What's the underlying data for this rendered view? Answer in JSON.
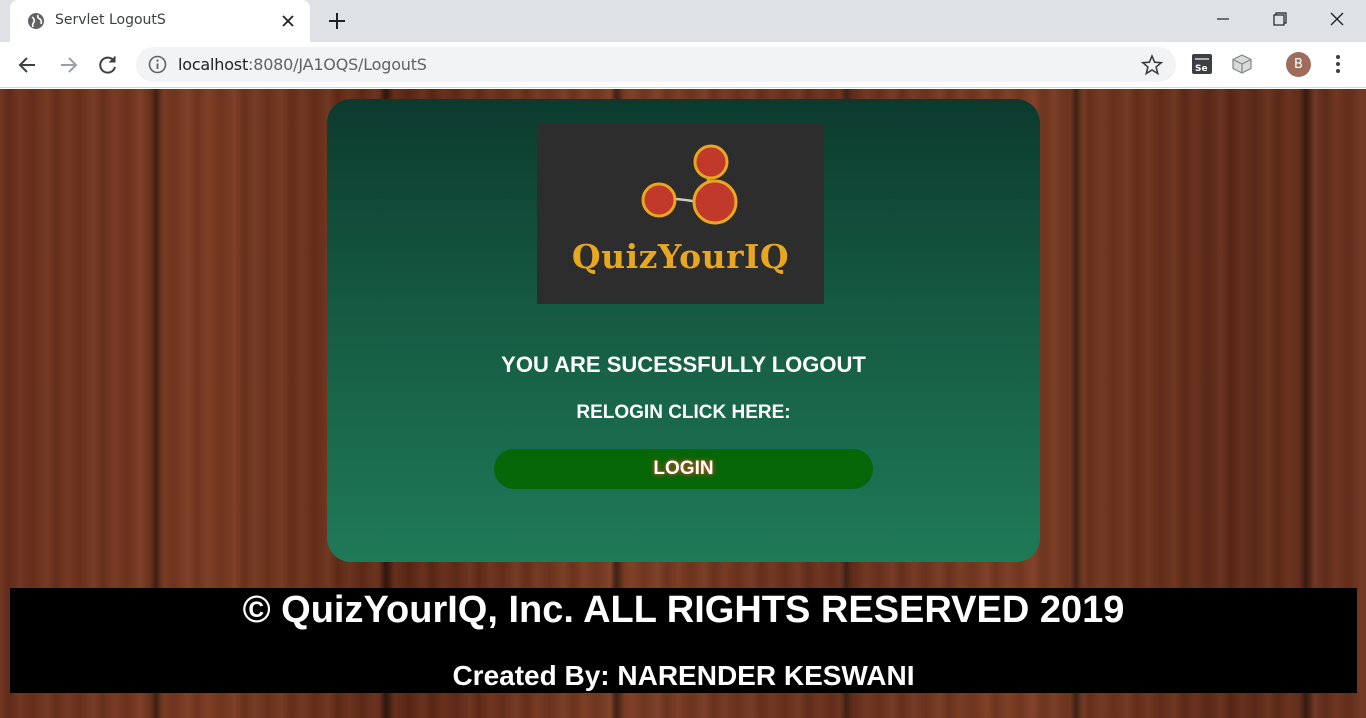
{
  "browser": {
    "tab_title": "Servlet LogoutS",
    "url_host": "localhost",
    "url_rest": ":8080/JA1OQS/LogoutS",
    "profile_initial": "B"
  },
  "page": {
    "logo_text": "QuizYourIQ",
    "heading": "YOU ARE SUCESSFULLY LOGOUT",
    "relogin_text": "RELOGIN CLICK HERE:",
    "login_label": "LOGIN",
    "footer_copyright": "© QuizYourIQ, Inc. ALL RIGHTS RESERVED 2019",
    "footer_credit": "Created By: NARENDER KESWANI"
  },
  "colors": {
    "card_top": "#0c3a2e",
    "card_bottom": "#1f7a58",
    "login_button": "#056708",
    "logo_text": "#e8a721",
    "footer_bg": "#000000"
  },
  "icons": [
    "globe-icon",
    "close-icon",
    "plus-icon",
    "minimize-icon",
    "restore-icon",
    "back-icon",
    "forward-icon",
    "reload-icon",
    "info-icon",
    "star-icon",
    "selenium-extension-icon",
    "cube-extension-icon",
    "menu-icon"
  ]
}
